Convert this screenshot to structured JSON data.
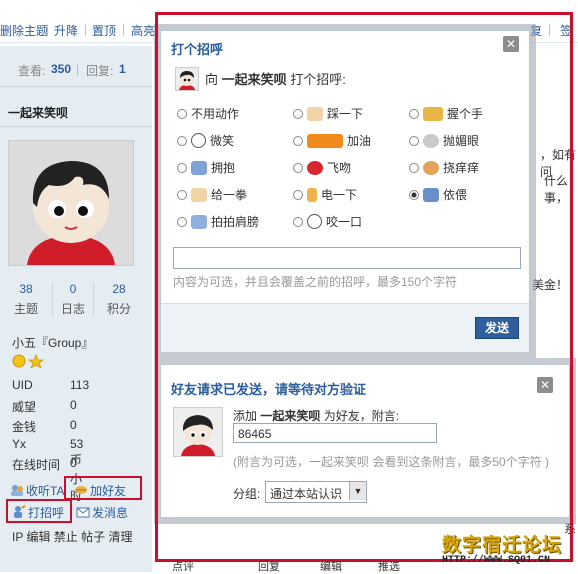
{
  "toolbar": {
    "items": [
      "删除主题",
      "升降",
      "置顶",
      "高亮"
    ],
    "right_items": [
      "复",
      "签"
    ]
  },
  "thread_stats": {
    "views_label": "查看:",
    "views": "350",
    "replies_label": "回复:",
    "replies": "1"
  },
  "user": {
    "name": "一起来笑呗",
    "stats": [
      {
        "value": "38",
        "label": "主题"
      },
      {
        "value": "0",
        "label": "日志"
      },
      {
        "value": "28",
        "label": "积分"
      }
    ],
    "group": "小五『Group』",
    "profile": [
      {
        "label": "UID",
        "value": "113"
      },
      {
        "label": "威望",
        "value": "0"
      },
      {
        "label": "金钱",
        "value": "0"
      },
      {
        "label": "Yx",
        "value": "53 币"
      },
      {
        "label": "在线时间",
        "value": "0 小时"
      }
    ],
    "actions": {
      "listen": "收听TA",
      "add_friend": "加好友",
      "greet": "打招呼",
      "message": "发消息"
    },
    "admin_links": "IP 编辑 禁止 帖子 清理"
  },
  "right_snippets": {
    "a": "，如有问",
    "b": "什么事，",
    "c": "美金！",
    "d": "系"
  },
  "greet_dialog": {
    "title": "打个招呼",
    "prompt_prefix": "向",
    "prompt_name": "一起来笑呗",
    "prompt_suffix": "打个招呼:",
    "options": [
      {
        "label": "不用动作",
        "icon": "none",
        "selected": false
      },
      {
        "label": "踩一下",
        "icon": "footprint-icon",
        "selected": false
      },
      {
        "label": "握个手",
        "icon": "handshake-icon",
        "selected": false
      },
      {
        "label": "微笑",
        "icon": "smile-icon",
        "selected": false
      },
      {
        "label": "加油",
        "icon": "cheer-icon",
        "selected": false
      },
      {
        "label": "抛媚眼",
        "icon": "wink-icon",
        "selected": false
      },
      {
        "label": "拥抱",
        "icon": "hug-icon",
        "selected": false
      },
      {
        "label": "飞吻",
        "icon": "kiss-icon",
        "selected": false
      },
      {
        "label": "挠痒痒",
        "icon": "tickle-icon",
        "selected": false
      },
      {
        "label": "给一拳",
        "icon": "punch-icon",
        "selected": false
      },
      {
        "label": "电一下",
        "icon": "lightning-icon",
        "selected": false
      },
      {
        "label": "依偎",
        "icon": "snuggle-icon",
        "selected": true
      },
      {
        "label": "拍拍肩膀",
        "icon": "pat-icon",
        "selected": false
      },
      {
        "label": "咬一口",
        "icon": "bite-icon",
        "selected": false
      }
    ],
    "hint": "内容为可选，并且会覆盖之前的招呼，最多150个字符",
    "send_label": "发送"
  },
  "friend_dialog": {
    "title": "好友请求已发送，请等待对方验证",
    "add_prefix": "添加",
    "add_name": "一起来笑呗",
    "add_suffix": "为好友，附言:",
    "note_value": "86465",
    "note_hint": "(附言为可选，一起来笑呗 会看到这条附言，最多50个字符 )",
    "group_label": "分组:",
    "group_value": "通过本站认识"
  },
  "bottom_bar": {
    "items": [
      "点评",
      "回复",
      "编辑",
      "推选"
    ]
  },
  "watermark": {
    "line1": "数字宿迁论坛",
    "line2": "HTTP://WWW.SQ01.CN"
  },
  "colors": {
    "highlight_red": "#c8102e",
    "link_blue": "#2a5d9f",
    "button_blue": "#2e5f9c",
    "side_bg": "#e5edf2"
  }
}
